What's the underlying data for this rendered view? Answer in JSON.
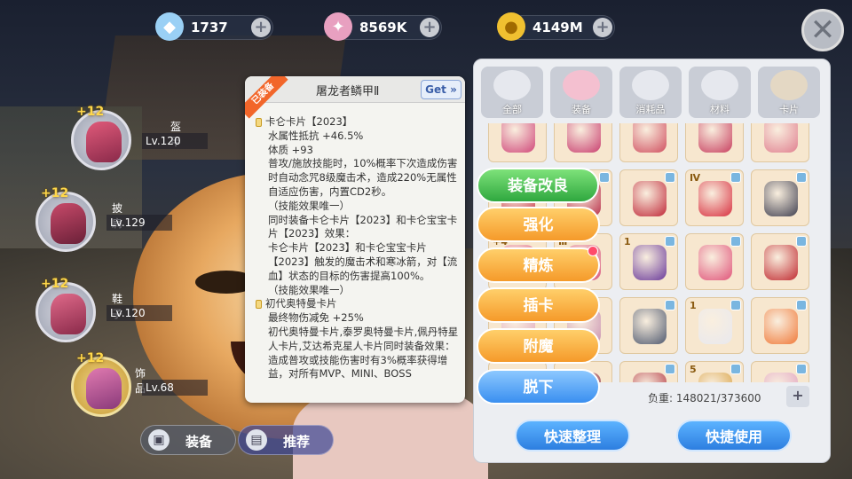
{
  "currencies": [
    {
      "icon": "diamond-icon",
      "value": "1737"
    },
    {
      "icon": "crystal-icon",
      "value": "8569K"
    },
    {
      "icon": "coin-icon",
      "value": "4149M"
    }
  ],
  "equip_slots": [
    {
      "name": "盔甲",
      "level": "Lv.120",
      "plus": "+12"
    },
    {
      "name": "披肩",
      "level": "Lv.129",
      "plus": "+12"
    },
    {
      "name": "鞋子",
      "level": "Lv.120",
      "plus": "+12"
    },
    {
      "name": "饰品",
      "level": "Lv.68",
      "plus": "+12"
    }
  ],
  "bottom_tabs": [
    {
      "label": "装备",
      "icon": "shirt-icon"
    },
    {
      "label": "推荐",
      "icon": "book-icon"
    }
  ],
  "tooltip": {
    "ribbon": "已装备",
    "title": "屠龙者鳞甲Ⅱ",
    "get_label": "Get »",
    "cards": [
      {
        "name": "卡仑卡片【2023】",
        "lines": [
          "水属性抵抗 +46.5%",
          "体质 +93",
          "普攻/施放技能时，10%概率下次造成伤害时自动念咒8级魔击术，造成220%无属性自适应伤害，内置CD2秒。",
          "（技能效果唯一）",
          "同时装备卡仑卡片【2023】和卡仑宝宝卡片【2023】效果：",
          "卡仑卡片【2023】和卡仑宝宝卡片【2023】触发的魔击术和寒冰箭，对【流血】状态的目标的伤害提高100%。",
          "（技能效果唯一）"
        ]
      },
      {
        "name": "初代奥特曼卡片",
        "lines": [
          "最终物伤减免 +25%",
          "初代奥特曼卡片,泰罗奥特曼卡片,佩丹特星人卡片,艾达希克星人卡片同时装备效果：",
          "造成普攻或技能伤害时有3%概率获得增益，对所有MVP、MINI、BOSS"
        ]
      }
    ]
  },
  "action_buttons": [
    {
      "label": "装备改良",
      "style": "green"
    },
    {
      "label": "强化",
      "style": "orange"
    },
    {
      "label": "精炼",
      "style": "orange"
    },
    {
      "label": "插卡",
      "style": "orange"
    },
    {
      "label": "附魔",
      "style": "orange"
    },
    {
      "label": "脱下",
      "style": "blue"
    }
  ],
  "inventory": {
    "tabs": [
      {
        "label": "全部",
        "icon": "helmet-icon"
      },
      {
        "label": "装备",
        "icon": "poring-icon"
      },
      {
        "label": "消耗品",
        "icon": "potion-icon"
      },
      {
        "label": "材料",
        "icon": "scroll-icon"
      },
      {
        "label": "卡片",
        "icon": "card-icon"
      }
    ],
    "rows": [
      [
        {
          "item": "pink-armor-icon",
          "color": "#d0487a",
          "lock": false,
          "badge": ""
        },
        {
          "item": "pink-armor-icon",
          "color": "#c94070",
          "lock": true,
          "badge": ""
        },
        {
          "item": "pink-armor-icon",
          "color": "#d05060",
          "lock": false,
          "badge": ""
        },
        {
          "item": "pink-armor-icon",
          "color": "#c84060",
          "lock": true,
          "badge": ""
        },
        {
          "item": "pink-armor-icon",
          "color": "#e08090",
          "lock": false,
          "badge": ""
        }
      ],
      [
        {
          "item": "red-armor-icon",
          "color": "#c83c4c",
          "lock": false,
          "badge": ""
        },
        {
          "item": "red-armor-icon",
          "color": "#b8304a",
          "lock": true,
          "badge": ""
        },
        {
          "item": "red-cloak-icon",
          "color": "#c02a3a",
          "lock": true,
          "badge": ""
        },
        {
          "item": "shield-icon",
          "color": "#d83040",
          "lock": true,
          "badge": "Ⅳ"
        },
        {
          "item": "figure-icon",
          "color": "#404050",
          "lock": true,
          "badge": ""
        }
      ],
      [
        {
          "item": "bracelet-icon",
          "color": "#e06a8a",
          "lock": false,
          "badge": "+4"
        },
        {
          "item": "bracelet-icon",
          "color": "#d8547c",
          "lock": false,
          "badge": "Ⅲ"
        },
        {
          "item": "purple-bracelet-icon",
          "color": "#6a3a9a",
          "lock": true,
          "badge": "1"
        },
        {
          "item": "pink-bracelet-icon",
          "color": "#e0547a",
          "lock": true,
          "badge": ""
        },
        {
          "item": "red-hat-icon",
          "color": "#c02a30",
          "lock": true,
          "badge": ""
        }
      ],
      [
        {
          "item": "ring-icon",
          "color": "#e0a8c0",
          "lock": false,
          "badge": ""
        },
        {
          "item": "ring-icon",
          "color": "#c890b0",
          "lock": false,
          "badge": ""
        },
        {
          "item": "necklace-icon",
          "color": "#505a70",
          "lock": true,
          "badge": ""
        },
        {
          "item": "scarf-icon",
          "color": "#e8e8ee",
          "lock": true,
          "badge": "1"
        },
        {
          "item": "flower-icon",
          "color": "#f07a3a",
          "lock": true,
          "badge": ""
        }
      ],
      [
        {
          "item": "blade-icon",
          "color": "#a03040",
          "lock": false,
          "badge": ""
        },
        {
          "item": "blade-icon",
          "color": "#903040",
          "lock": false,
          "badge": ""
        },
        {
          "item": "dagger-icon",
          "color": "#b0303c",
          "lock": true,
          "badge": ""
        },
        {
          "item": "golden-item-icon",
          "color": "#d8a040",
          "lock": true,
          "badge": "5"
        },
        {
          "item": "orb-icon",
          "color": "#e0a0c0",
          "lock": true,
          "badge": ""
        }
      ]
    ],
    "weight_label": "负重: 148021/373600",
    "buttons": [
      {
        "label": "快速整理"
      },
      {
        "label": "快捷使用"
      }
    ]
  }
}
